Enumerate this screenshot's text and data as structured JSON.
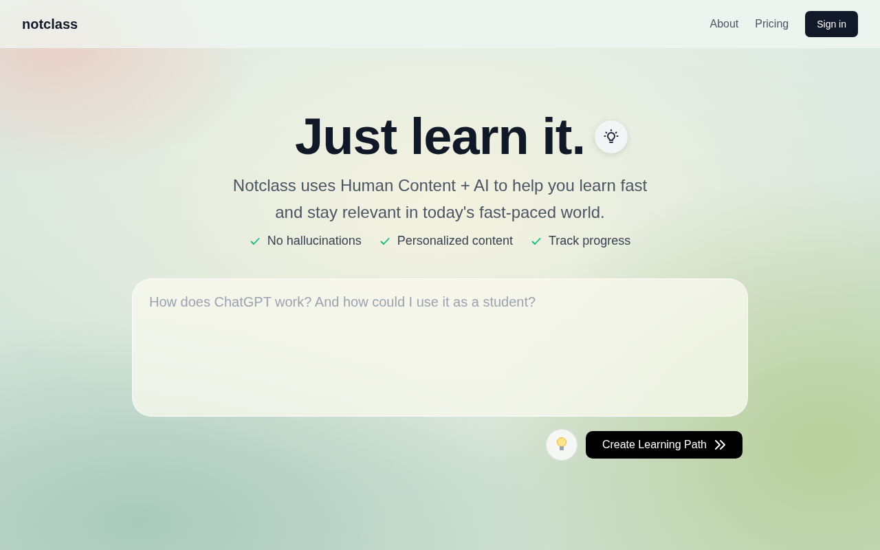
{
  "header": {
    "logo": "notclass",
    "nav_links": [
      "About",
      "Pricing"
    ],
    "sign_in": "Sign in"
  },
  "hero": {
    "title": "Just learn it.",
    "subtitle_lines": [
      "Notclass uses Human Content + AI to help you learn fast",
      "and stay relevant in today's fast-paced world."
    ],
    "features": [
      "No hallucinations",
      "Personalized content",
      "Track progress"
    ]
  },
  "prompt": {
    "placeholder": "How does ChatGPT work? And how could I use it as a student?",
    "submit": "Create Learning Path"
  }
}
